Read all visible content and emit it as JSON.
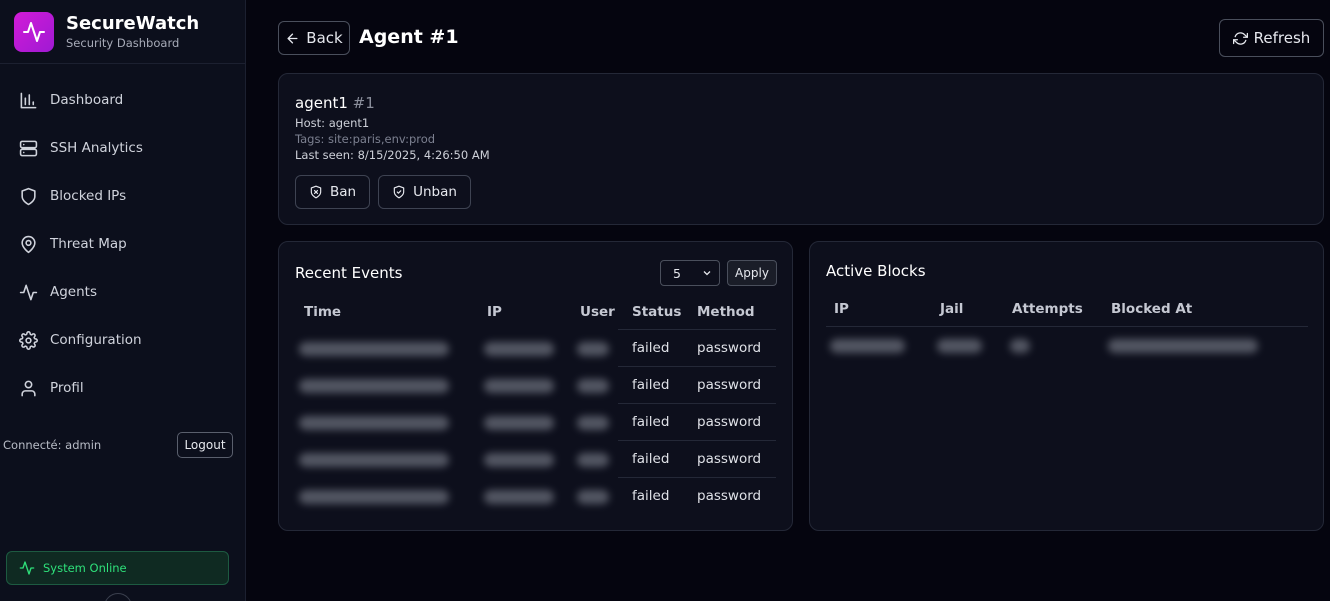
{
  "brand": {
    "title": "SecureWatch",
    "subtitle": "Security Dashboard"
  },
  "sidebar": {
    "items": [
      {
        "label": "Dashboard",
        "icon": "bar-chart-icon"
      },
      {
        "label": "SSH Analytics",
        "icon": "server-icon"
      },
      {
        "label": "Blocked IPs",
        "icon": "shield-icon"
      },
      {
        "label": "Threat Map",
        "icon": "map-pin-icon"
      },
      {
        "label": "Agents",
        "icon": "activity-icon"
      },
      {
        "label": "Configuration",
        "icon": "gear-icon"
      },
      {
        "label": "Profil",
        "icon": "user-icon"
      }
    ],
    "connected": "Connecté: admin",
    "logout": "Logout",
    "status": "System Online"
  },
  "header": {
    "back": "Back",
    "title": "Agent #1",
    "refresh": "Refresh"
  },
  "agent": {
    "name": "agent1",
    "id": "#1",
    "host": "Host: agent1",
    "tags": "Tags: site:paris,env:prod",
    "last_seen": "Last seen: 8/15/2025, 4:26:50 AM",
    "ban": "Ban",
    "unban": "Unban"
  },
  "events": {
    "title": "Recent Events",
    "limit": "5",
    "apply": "Apply",
    "columns": [
      "Time",
      "IP",
      "User",
      "Status",
      "Method"
    ],
    "rows": [
      {
        "status": "failed",
        "method": "password"
      },
      {
        "status": "failed",
        "method": "password"
      },
      {
        "status": "failed",
        "method": "password"
      },
      {
        "status": "failed",
        "method": "password"
      },
      {
        "status": "failed",
        "method": "password"
      }
    ]
  },
  "blocks": {
    "title": "Active Blocks",
    "columns": [
      "IP",
      "Jail",
      "Attempts",
      "Blocked At"
    ]
  },
  "colors": {
    "accent": "#d21bd6",
    "online": "#2ee07a",
    "background": "#05050f",
    "card": "#0d0f1c"
  }
}
